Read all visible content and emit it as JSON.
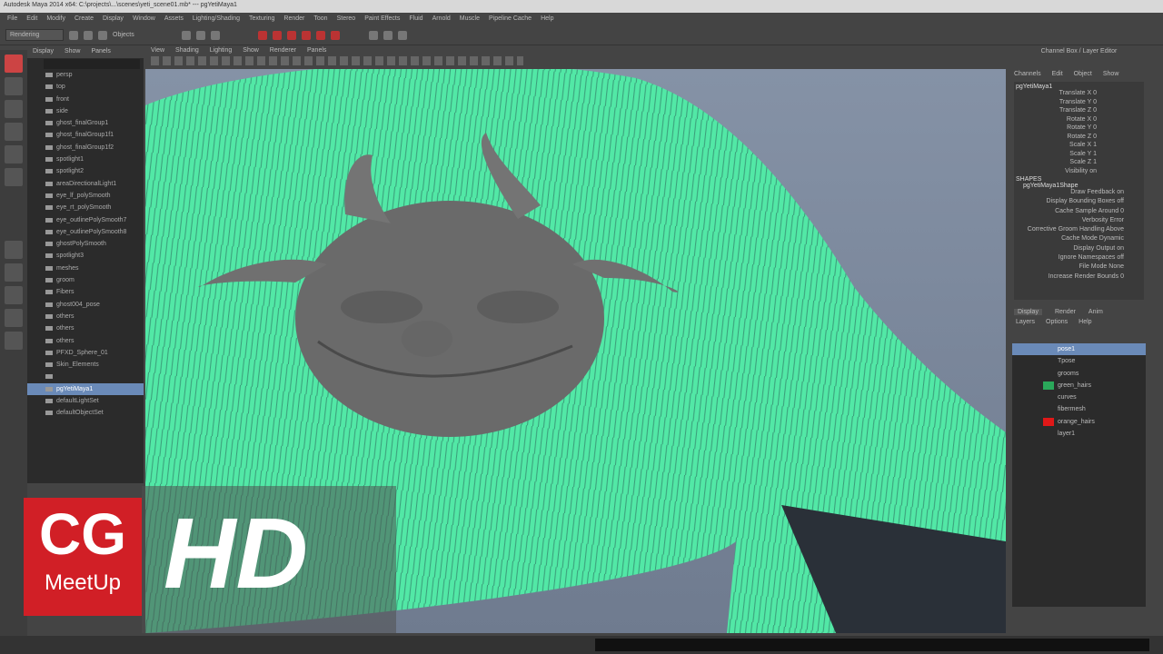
{
  "window": {
    "title": "Autodesk Maya 2014 x64: C:\\projects\\...\\scenes\\yeti_scene01.mb* --- pgYetiMaya1"
  },
  "menu": [
    "File",
    "Edit",
    "Modify",
    "Create",
    "Display",
    "Window",
    "Assets",
    "Lighting/Shading",
    "Texturing",
    "Render",
    "Toon",
    "Stereo",
    "Paint Effects",
    "Fluid",
    "Arnold",
    "Muscle",
    "Pipeline Cache",
    "Help"
  ],
  "shelf": {
    "mode": "Rendering",
    "objects_label": "Objects"
  },
  "outliner": {
    "menu": [
      "Display",
      "Show",
      "Panels"
    ],
    "items": [
      "persp",
      "top",
      "front",
      "side",
      "ghost_finalGroup1",
      "ghost_finalGroup1f1",
      "ghost_finalGroup1f2",
      "spotlight1",
      "spotlight2",
      "areaDirectionalLight1",
      "eye_lf_polySmooth",
      "eye_rt_polySmooth",
      "eye_outlinePolySmooth7",
      "eye_outlinePolySmooth8",
      "ghostPolySmooth",
      "spotlight3",
      "meshes",
      "groom",
      "Fibers",
      "ghost004_pose",
      "others",
      "others",
      "others",
      "PFXD_Sphere_01",
      "Skin_Elements",
      "",
      "pgYetiMaya1",
      "defaultLightSet",
      "defaultObjectSet"
    ],
    "selected_index": 26
  },
  "viewport": {
    "menu": [
      "View",
      "Shading",
      "Lighting",
      "Show",
      "Renderer",
      "Panels"
    ]
  },
  "channel_box": {
    "title": "Channel Box / Layer Editor",
    "menu": [
      "Channels",
      "Edit",
      "Object",
      "Show"
    ],
    "node": "pgYetiMaya1",
    "channels": [
      "Translate X 0",
      "Translate Y 0",
      "Translate Z 0",
      "Rotate X 0",
      "Rotate Y 0",
      "Rotate Z 0",
      "Scale X 1",
      "Scale Y 1",
      "Scale Z 1",
      "Visibility on"
    ],
    "shapes_label": "SHAPES",
    "shape_node": "pgYetiMaya1Shape",
    "shape_attrs": [
      "Draw Feedback on",
      "Display Bounding Boxes off",
      "Cache Sample Around 0",
      "Verbosity Error",
      "Corrective Groom Handling Above",
      "Cache Mode Dynamic",
      "Display Output on",
      "Ignore Namespaces off",
      "File Mode None",
      "Increase Render Bounds 0"
    ]
  },
  "layers": {
    "tabs": [
      "Display",
      "Render",
      "Anim"
    ],
    "menu": [
      "Layers",
      "Options",
      "Help"
    ],
    "items": [
      {
        "name": "pose1",
        "color": ""
      },
      {
        "name": "Tpose",
        "color": ""
      },
      {
        "name": "grooms",
        "color": ""
      },
      {
        "name": "green_hairs",
        "color": "#2aa85a"
      },
      {
        "name": "curves",
        "color": ""
      },
      {
        "name": "fibermesh",
        "color": ""
      },
      {
        "name": "orange_hairs",
        "color": "#e01818"
      },
      {
        "name": "layer1",
        "color": ""
      }
    ]
  },
  "logo": {
    "text1": "CG",
    "text2": "MeetUp",
    "text3": "HD"
  },
  "colors": {
    "fur": "#52e8a6",
    "selection": "#6a8ab8"
  }
}
